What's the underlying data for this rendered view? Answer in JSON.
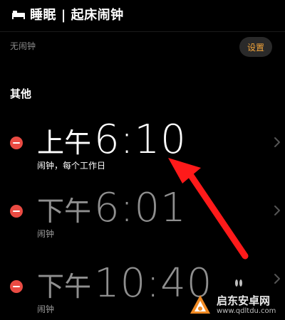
{
  "header": {
    "title": "睡眠 | 起床闹钟"
  },
  "no_alarm": "无闹钟",
  "settings_label": "设置",
  "section_title": "其他",
  "alarms": [
    {
      "meridiem": "上午",
      "time": "6:10",
      "label": "闹钟，每个工作日",
      "enabled": true
    },
    {
      "meridiem": "下午",
      "time": "6:01",
      "label": "闹钟",
      "enabled": false
    },
    {
      "meridiem": "下午",
      "time": "10:40",
      "label": "闹钟",
      "enabled": false
    }
  ],
  "watermark": {
    "name": "启东安卓网",
    "url": "www.qdltdu.com"
  },
  "colors": {
    "background": "#000000",
    "accent": "#f4a53a",
    "delete": "#ea4b43",
    "annotation_arrow": "#ff1a1a"
  }
}
